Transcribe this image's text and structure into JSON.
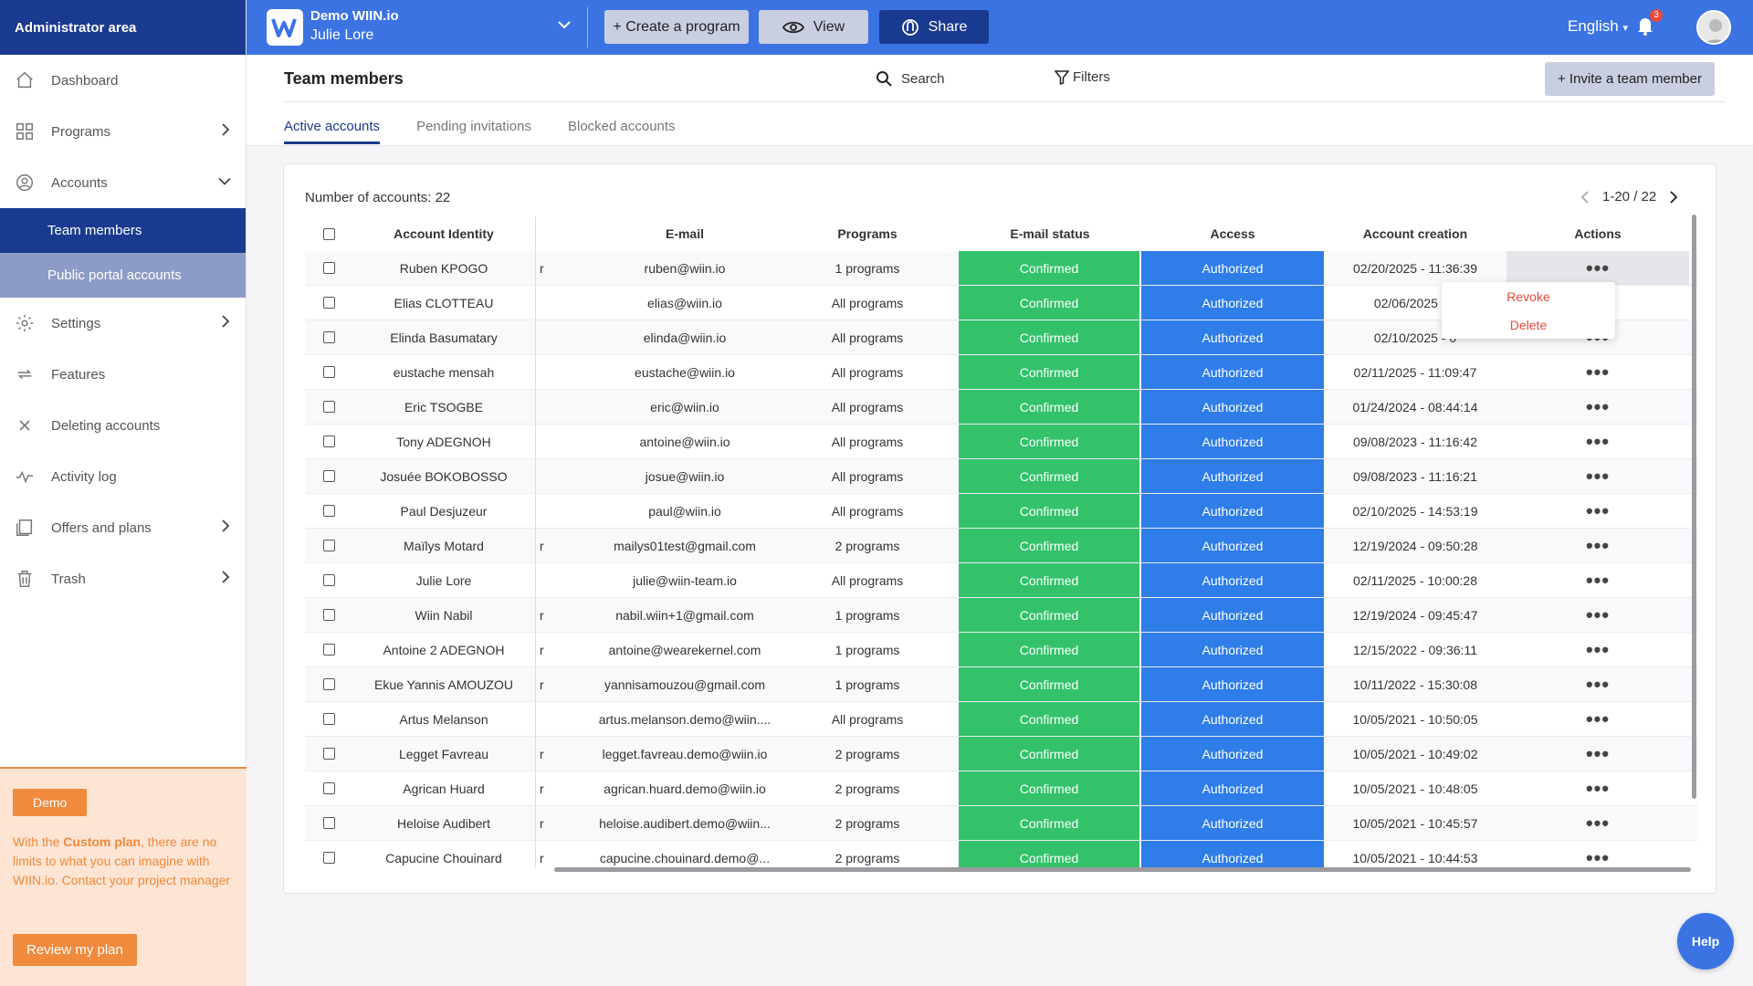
{
  "sidebar": {
    "header": "Administrator area",
    "items": [
      {
        "label": "Dashboard",
        "icon": "home-icon"
      },
      {
        "label": "Programs",
        "icon": "grid-icon"
      },
      {
        "label": "Accounts",
        "icon": "user-circle-icon"
      },
      {
        "label": "Settings",
        "icon": "gear-icon"
      },
      {
        "label": "Features",
        "icon": "arrows-icon"
      },
      {
        "label": "Deleting accounts",
        "icon": "close-icon"
      },
      {
        "label": "Activity log",
        "icon": "pulse-icon"
      },
      {
        "label": "Offers and plans",
        "icon": "pages-icon"
      },
      {
        "label": "Trash",
        "icon": "trash-icon"
      }
    ],
    "sub": {
      "team": "Team members",
      "portal": "Public portal accounts"
    },
    "promo": {
      "badge": "Demo",
      "text_before": "With the ",
      "text_bold": "Custom plan",
      "text_after": ", there are no limits to what you can imagine with WIIN.io. Contact your project manager",
      "button": "Review my plan"
    }
  },
  "topbar": {
    "org_name": "Demo WIIN.io",
    "user_name": "Julie Lore",
    "create_label": "+ Create a program",
    "view_label": "View",
    "share_label": "Share",
    "language": "English",
    "notifications": "3",
    "colors": {
      "primary": "#3b73e3",
      "dark": "#1a3a8f"
    }
  },
  "page": {
    "title": "Team members",
    "search": "Search",
    "filters": "Filters",
    "invite": "+ Invite a team member",
    "tabs": [
      "Active accounts",
      "Pending invitations",
      "Blocked accounts"
    ]
  },
  "table": {
    "count_label": "Number of accounts: 22",
    "pager": "1-20 / 22",
    "headers": {
      "id": "Account Identity",
      "mail": "E-mail",
      "prog": "Programs",
      "status": "E-mail status",
      "access": "Access",
      "date": "Account creation",
      "actions": "Actions"
    },
    "rows": [
      {
        "name": "Ruben KPOGO",
        "flag": "r",
        "email": "ruben@wiin.io",
        "programs": "1 programs",
        "status": "Confirmed",
        "access": "Authorized",
        "date": "02/20/2025 - 11:36:39"
      },
      {
        "name": "Elias CLOTTEAU",
        "flag": "",
        "email": "elias@wiin.io",
        "programs": "All programs",
        "status": "Confirmed",
        "access": "Authorized",
        "date": "02/06/2025 - 0"
      },
      {
        "name": "Elinda Basumatary",
        "flag": "",
        "email": "elinda@wiin.io",
        "programs": "All programs",
        "status": "Confirmed",
        "access": "Authorized",
        "date": "02/10/2025 - 0"
      },
      {
        "name": "eustache mensah",
        "flag": "",
        "email": "eustache@wiin.io",
        "programs": "All programs",
        "status": "Confirmed",
        "access": "Authorized",
        "date": "02/11/2025 - 11:09:47"
      },
      {
        "name": "Eric TSOGBE",
        "flag": "",
        "email": "eric@wiin.io",
        "programs": "All programs",
        "status": "Confirmed",
        "access": "Authorized",
        "date": "01/24/2024 - 08:44:14"
      },
      {
        "name": "Tony ADEGNOH",
        "flag": "",
        "email": "antoine@wiin.io",
        "programs": "All programs",
        "status": "Confirmed",
        "access": "Authorized",
        "date": "09/08/2023 - 11:16:42"
      },
      {
        "name": "Josuée BOKOBOSSO",
        "flag": "",
        "email": "josue@wiin.io",
        "programs": "All programs",
        "status": "Confirmed",
        "access": "Authorized",
        "date": "09/08/2023 - 11:16:21"
      },
      {
        "name": "Paul Desjuzeur",
        "flag": "",
        "email": "paul@wiin.io",
        "programs": "All programs",
        "status": "Confirmed",
        "access": "Authorized",
        "date": "02/10/2025 - 14:53:19"
      },
      {
        "name": "Maïlys Motard",
        "flag": "r",
        "email": "mailys01test@gmail.com",
        "programs": "2 programs",
        "status": "Confirmed",
        "access": "Authorized",
        "date": "12/19/2024 - 09:50:28"
      },
      {
        "name": "Julie Lore",
        "flag": "",
        "email": "julie@wiin-team.io",
        "programs": "All programs",
        "status": "Confirmed",
        "access": "Authorized",
        "date": "02/11/2025 - 10:00:28"
      },
      {
        "name": "Wiin Nabil",
        "flag": "r",
        "email": "nabil.wiin+1@gmail.com",
        "programs": "1 programs",
        "status": "Confirmed",
        "access": "Authorized",
        "date": "12/19/2024 - 09:45:47"
      },
      {
        "name": "Antoine 2 ADEGNOH",
        "flag": "r",
        "email": "antoine@wearekernel.com",
        "programs": "1 programs",
        "status": "Confirmed",
        "access": "Authorized",
        "date": "12/15/2022 - 09:36:11"
      },
      {
        "name": "Ekue Yannis AMOUZOU",
        "flag": "r",
        "email": "yannisamouzou@gmail.com",
        "programs": "1 programs",
        "status": "Confirmed",
        "access": "Authorized",
        "date": "10/11/2022 - 15:30:08"
      },
      {
        "name": "Artus Melanson",
        "flag": "",
        "email": "artus.melanson.demo@wiin....",
        "programs": "All programs",
        "status": "Confirmed",
        "access": "Authorized",
        "date": "10/05/2021 - 10:50:05"
      },
      {
        "name": "Legget Favreau",
        "flag": "r",
        "email": "legget.favreau.demo@wiin.io",
        "programs": "2 programs",
        "status": "Confirmed",
        "access": "Authorized",
        "date": "10/05/2021 - 10:49:02"
      },
      {
        "name": "Agrican Huard",
        "flag": "r",
        "email": "agrican.huard.demo@wiin.io",
        "programs": "2 programs",
        "status": "Confirmed",
        "access": "Authorized",
        "date": "10/05/2021 - 10:48:05"
      },
      {
        "name": "Heloise Audibert",
        "flag": "r",
        "email": "heloise.audibert.demo@wiin...",
        "programs": "2 programs",
        "status": "Confirmed",
        "access": "Authorized",
        "date": "10/05/2021 - 10:45:57"
      },
      {
        "name": "Capucine Chouinard",
        "flag": "r",
        "email": "capucine.chouinard.demo@...",
        "programs": "2 programs",
        "status": "Confirmed",
        "access": "Authorized",
        "date": "10/05/2021 - 10:44:53"
      }
    ],
    "row_menu": [
      "Revoke",
      "Delete"
    ]
  },
  "help_label": "Help"
}
